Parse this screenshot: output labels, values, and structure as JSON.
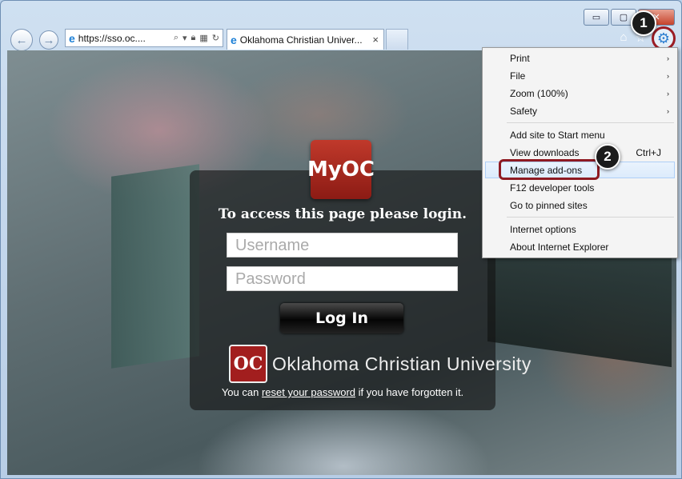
{
  "browser": {
    "address": "https://sso.oc....",
    "tab_title": "Oklahoma Christian Univer...",
    "tab_close": "×",
    "window_buttons": {
      "minimize": "▭",
      "maximize": "▢",
      "close": "✕"
    },
    "icons": [
      "back-icon",
      "forward-icon",
      "ie-icon",
      "search-icon",
      "lock-icon",
      "refresh-icon",
      "home-icon",
      "star-icon",
      "gear-icon"
    ]
  },
  "callouts": {
    "one": "1",
    "two": "2"
  },
  "page": {
    "logo_text": "MyOC",
    "heading": "To access this page please login.",
    "username_placeholder": "Username",
    "password_placeholder": "Password",
    "login_button": "Log In",
    "university_badge": "OC",
    "university_name": "Oklahoma Christian University",
    "reset_prefix": "You can",
    "reset_link": "reset your password",
    "reset_suffix": "if you have forgotten it."
  },
  "menu": {
    "items": [
      {
        "label": "Print",
        "submenu": "›"
      },
      {
        "label": "File",
        "submenu": "›"
      },
      {
        "label": "Zoom (100%)",
        "submenu": "›"
      },
      {
        "label": "Safety",
        "submenu": "›"
      },
      {
        "label": "Add site to Start menu"
      },
      {
        "label": "View downloads",
        "shortcut": "Ctrl+J"
      },
      {
        "label": "Manage add-ons"
      },
      {
        "label": "F12 developer tools"
      },
      {
        "label": "Go to pinned sites"
      },
      {
        "label": "Internet options"
      },
      {
        "label": "About Internet Explorer"
      }
    ]
  },
  "colors": {
    "highlight_ring": "#8e1a22",
    "ie_blue": "#1b7fd6",
    "oc_red": "#a21e1e"
  }
}
